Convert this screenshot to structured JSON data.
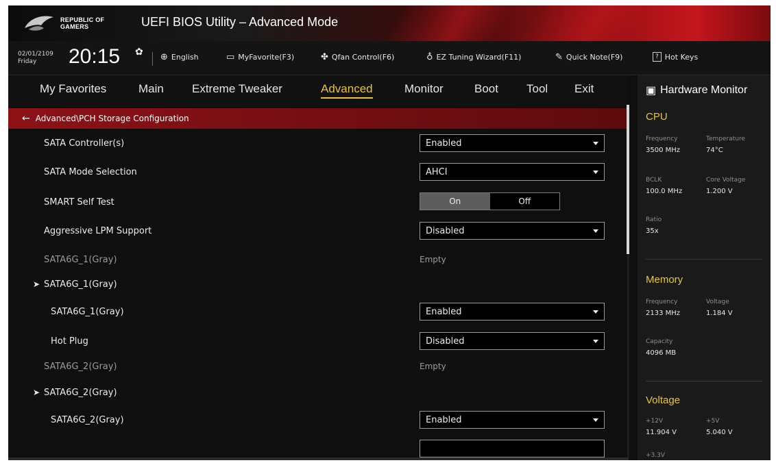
{
  "header": {
    "brand_line1": "REPUBLIC OF",
    "brand_line2": "GAMERS",
    "title": "UEFI BIOS Utility – Advanced Mode"
  },
  "infobar": {
    "date": "02/01/2109",
    "day": "Friday",
    "time": "20:15",
    "items": [
      {
        "label": "English",
        "icon": "globe-icon"
      },
      {
        "label": "MyFavorite(F3)",
        "icon": "favorite-icon"
      },
      {
        "label": "Qfan Control(F6)",
        "icon": "fan-icon"
      },
      {
        "label": "EZ Tuning Wizard(F11)",
        "icon": "bulb-icon"
      },
      {
        "label": "Quick Note(F9)",
        "icon": "note-icon"
      },
      {
        "label": "Hot Keys",
        "icon": "hotkeys-icon"
      }
    ],
    "hotkeys_glyph": "?"
  },
  "menu": {
    "items": [
      "My Favorites",
      "Main",
      "Extreme Tweaker",
      "Advanced",
      "Monitor",
      "Boot",
      "Tool",
      "Exit"
    ],
    "active": "Advanced"
  },
  "breadcrumb": {
    "path": "Advanced\\PCH Storage Configuration"
  },
  "settings": [
    {
      "label": "SATA Controller(s)",
      "type": "dropdown",
      "value": "Enabled"
    },
    {
      "label": "SATA Mode Selection",
      "type": "dropdown",
      "value": "AHCI"
    },
    {
      "label": "SMART Self Test",
      "type": "toggle",
      "options": [
        "On",
        "Off"
      ],
      "selected": "On"
    },
    {
      "label": "Aggressive LPM Support",
      "type": "dropdown",
      "value": "Disabled"
    },
    {
      "label": "SATA6G_1(Gray)",
      "type": "static",
      "value": "Empty"
    },
    {
      "label": "SATA6G_1(Gray)",
      "type": "expander"
    },
    {
      "label": "SATA6G_1(Gray)",
      "type": "dropdown",
      "value": "Enabled"
    },
    {
      "label": "Hot Plug",
      "type": "dropdown",
      "value": "Disabled"
    },
    {
      "label": "SATA6G_2(Gray)",
      "type": "static",
      "value": "Empty"
    },
    {
      "label": "SATA6G_2(Gray)",
      "type": "expander"
    },
    {
      "label": "SATA6G_2(Gray)",
      "type": "dropdown",
      "value": "Enabled"
    }
  ],
  "hardware_monitor": {
    "title": "Hardware Monitor",
    "cpu": {
      "heading": "CPU",
      "frequency_label": "Frequency",
      "frequency": "3500 MHz",
      "temperature_label": "Temperature",
      "temperature": "74°C",
      "bclk_label": "BCLK",
      "bclk": "100.0 MHz",
      "core_voltage_label": "Core Voltage",
      "core_voltage": "1.200 V",
      "ratio_label": "Ratio",
      "ratio": "35x"
    },
    "memory": {
      "heading": "Memory",
      "frequency_label": "Frequency",
      "frequency": "2133 MHz",
      "voltage_label": "Voltage",
      "voltage": "1.184 V",
      "capacity_label": "Capacity",
      "capacity": "4096 MB"
    },
    "voltage": {
      "heading": "Voltage",
      "v12_label": "+12V",
      "v12": "11.904 V",
      "v5_label": "+5V",
      "v5": "5.040 V",
      "v33_label": "+3.3V"
    }
  }
}
